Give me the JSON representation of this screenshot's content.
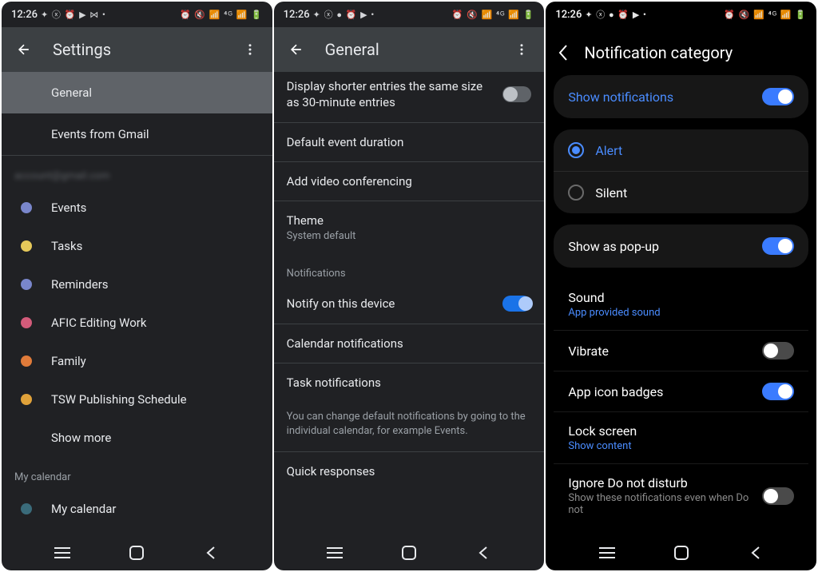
{
  "status": {
    "time": "12:26"
  },
  "screen1": {
    "title": "Settings",
    "items": [
      {
        "label": "General",
        "selected": true
      },
      {
        "label": "Events from Gmail"
      }
    ],
    "calendars": [
      {
        "label": "Events",
        "color": "#7986cb"
      },
      {
        "label": "Tasks",
        "color": "#e6c95a"
      },
      {
        "label": "Reminders",
        "color": "#7986cb"
      },
      {
        "label": "AFIC Editing Work",
        "color": "#d35b7a"
      },
      {
        "label": "Family",
        "color": "#e07b3a"
      },
      {
        "label": "TSW Publishing Schedule",
        "color": "#e0a23a"
      },
      {
        "label": "Show more"
      }
    ],
    "mycal_header": "My calendar",
    "mycal_item": {
      "label": "My calendar",
      "color": "#3a6b7a"
    }
  },
  "screen2": {
    "title": "General",
    "display_shorter": "Display shorter entries the same size as 30-minute entries",
    "default_duration": "Default event duration",
    "video_conf": "Add video conferencing",
    "theme": {
      "title": "Theme",
      "sub": "System default"
    },
    "section_notifications": "Notifications",
    "notify_device": "Notify on this device",
    "cal_notifs": "Calendar notifications",
    "task_notifs": "Task notifications",
    "help": "You can change default notifications by going to the individual calendar, for example Events.",
    "quick": "Quick responses"
  },
  "screen3": {
    "title": "Notification category",
    "show_notifications": "Show notifications",
    "alert": "Alert",
    "silent": "Silent",
    "popup": "Show as pop-up",
    "sound": {
      "title": "Sound",
      "sub": "App provided sound"
    },
    "vibrate": "Vibrate",
    "badges": "App icon badges",
    "lock": {
      "title": "Lock screen",
      "sub": "Show content"
    },
    "dnd": {
      "title": "Ignore Do not disturb",
      "sub": "Show these notifications even when Do not"
    }
  }
}
